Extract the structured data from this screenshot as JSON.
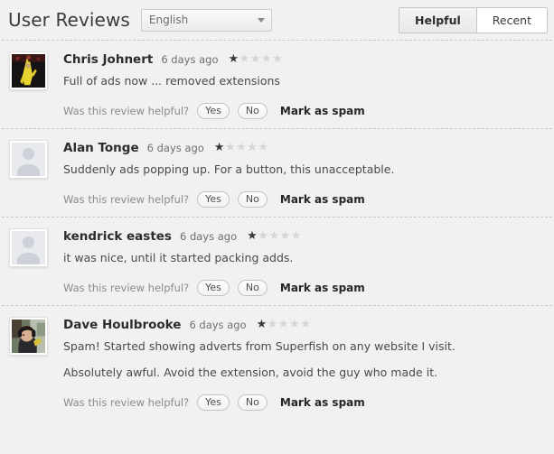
{
  "header": {
    "title": "User Reviews",
    "language": {
      "selected": "English",
      "caret": "chevron-down-icon"
    },
    "sort": {
      "helpful_label": "Helpful",
      "recent_label": "Recent",
      "active": "Helpful"
    }
  },
  "labels": {
    "helpful_question": "Was this review helpful?",
    "yes": "Yes",
    "no": "No",
    "mark_as_spam": "Mark as spam",
    "star_filled": "★",
    "star_empty": "★"
  },
  "colors": {
    "page_background": "#f1f1f1",
    "text_primary": "#333333",
    "text_muted": "#8b8b8b",
    "star_filled": "#3a3a3a",
    "star_empty": "#d6d6d6",
    "divider": "#c8c8c8"
  },
  "reviews": [
    {
      "author": "Chris Johnert",
      "timestamp": "6 days ago",
      "rating": 1,
      "max_rating": 5,
      "avatar": "photo-banana-costume",
      "paragraphs": [
        "Full of ads now ... removed extensions"
      ]
    },
    {
      "author": "Alan Tonge",
      "timestamp": "6 days ago",
      "rating": 1,
      "max_rating": 5,
      "avatar": "default-silhouette",
      "paragraphs": [
        "Suddenly ads popping up. For a button, this unacceptable."
      ]
    },
    {
      "author": "kendrick eastes",
      "timestamp": "6 days ago",
      "rating": 1,
      "max_rating": 5,
      "avatar": "default-silhouette",
      "paragraphs": [
        "it was nice, until it started packing adds."
      ]
    },
    {
      "author": "Dave Houlbrooke",
      "timestamp": "6 days ago",
      "rating": 1,
      "max_rating": 5,
      "avatar": "photo-headphones-man",
      "paragraphs": [
        "Spam! Started showing adverts from Superfish on any website I visit.",
        "Absolutely awful. Avoid the extension, avoid the guy who made it."
      ]
    }
  ]
}
